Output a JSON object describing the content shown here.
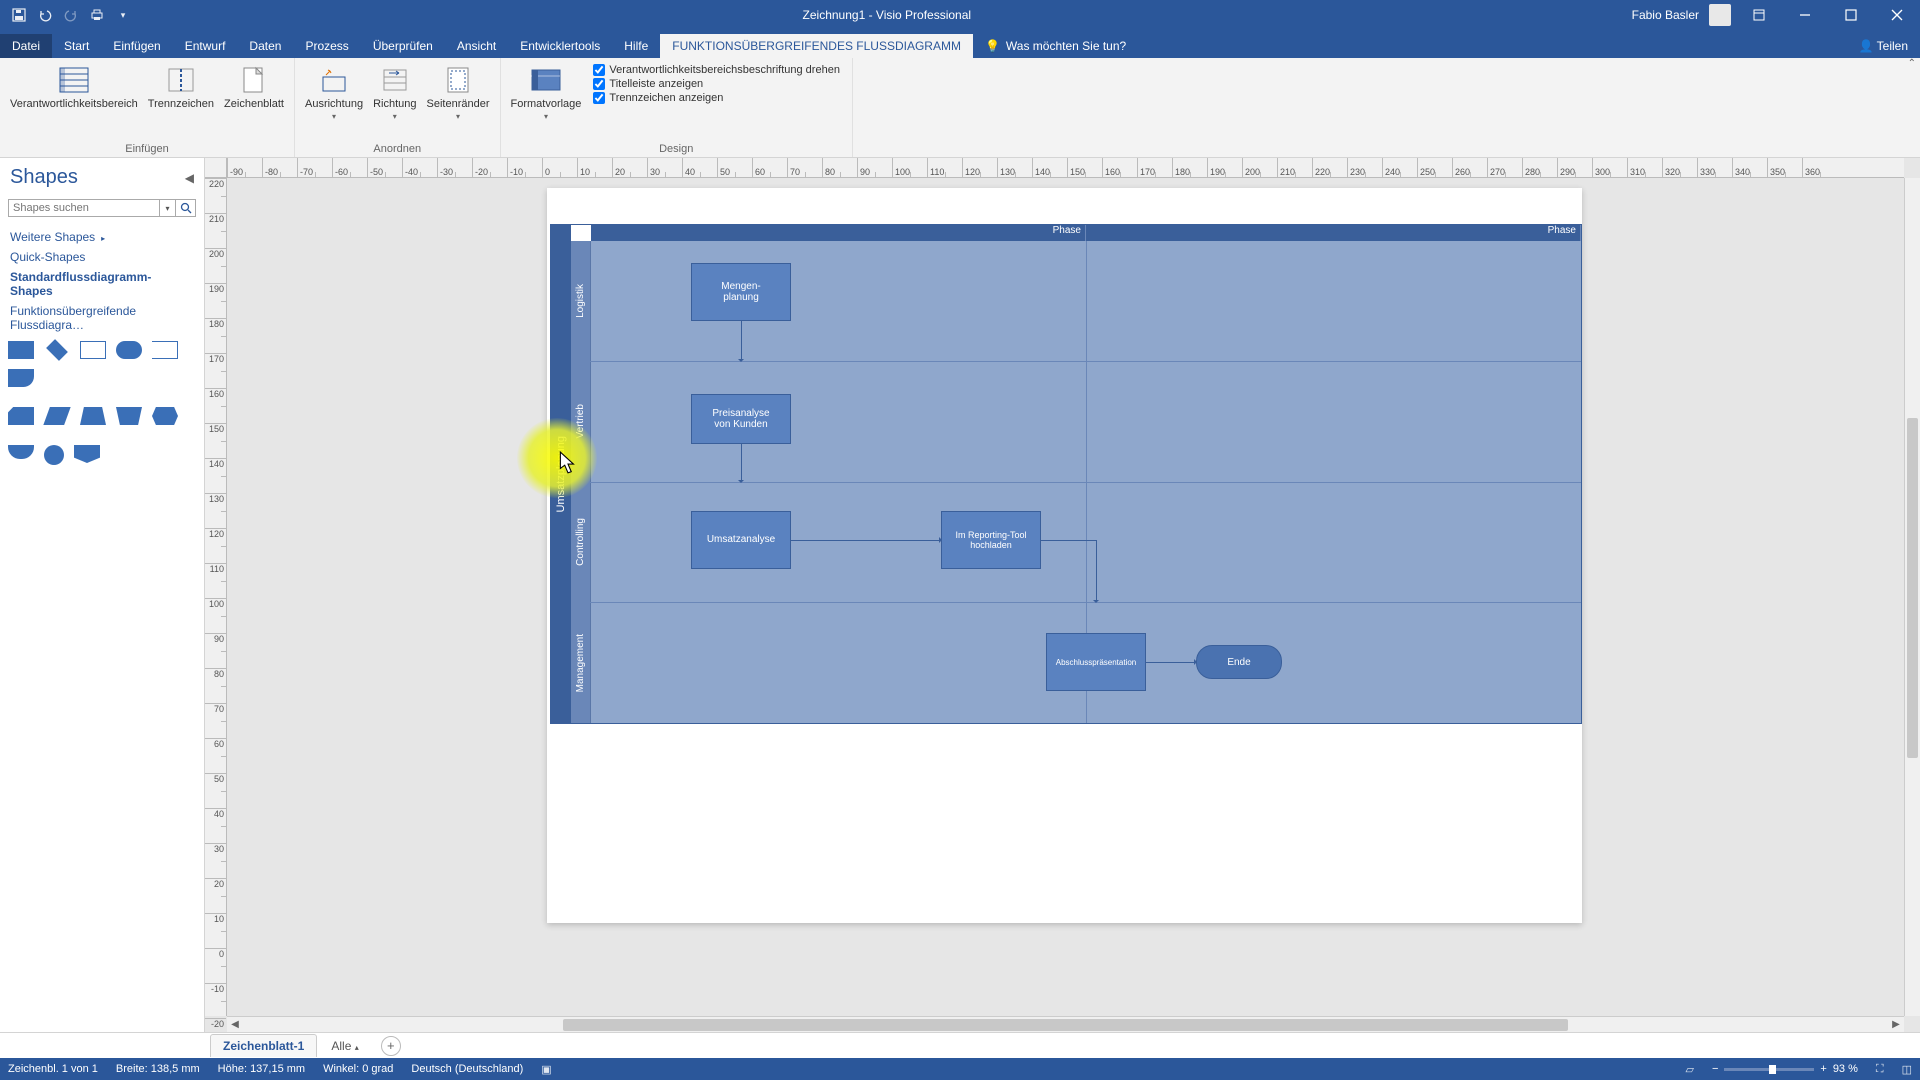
{
  "app": {
    "title": "Zeichnung1  -  Visio Professional",
    "user": "Fabio Basler"
  },
  "tabs": {
    "file": "Datei",
    "items": [
      "Start",
      "Einfügen",
      "Entwurf",
      "Daten",
      "Prozess",
      "Überprüfen",
      "Ansicht",
      "Entwicklertools",
      "Hilfe",
      "FUNKTIONSÜBERGREIFENDES FLUSSDIAGRAMM"
    ],
    "tell_placeholder": "Was möchten Sie tun?",
    "share": "Teilen"
  },
  "ribbon": {
    "insert": {
      "label": "Einfügen",
      "swimlane": "Verantwortlichkeitsbereich",
      "separator": "Trennzeichen",
      "page": "Zeichenblatt"
    },
    "arrange": {
      "label": "Anordnen",
      "orientation": "Ausrichtung",
      "direction": "Richtung",
      "margins": "Seitenränder"
    },
    "design": {
      "label": "Design",
      "style": "Formatvorlage",
      "rotate": "Verantwortlichkeitsbereichsbeschriftung drehen",
      "titlebar": "Titelleiste anzeigen",
      "separators": "Trennzeichen anzeigen"
    }
  },
  "shapes": {
    "title": "Shapes",
    "search_placeholder": "Shapes suchen",
    "more": "Weitere Shapes",
    "quick": "Quick-Shapes",
    "std": "Standardflussdiagramm-Shapes",
    "cross": "Funktionsübergreifende Flussdiagra…"
  },
  "diagram": {
    "main_title": "Umsatzplanung",
    "phase": "Phase",
    "lanes": [
      "Logistik",
      "Vertrieb",
      "Controlling",
      "Management"
    ],
    "nodes": {
      "n1": "Mengen-\nplanung",
      "n2": "Preisanalyse\nvon Kunden",
      "n3": "Umsatzanalyse",
      "n4": "Im Reporting-Tool\nhochladen",
      "n5": "Abschlusspräsentation",
      "n6": "Ende"
    }
  },
  "pagetabs": {
    "page1": "Zeichenblatt-1",
    "all": "Alle"
  },
  "status": {
    "page": "Zeichenbl. 1 von 1",
    "width": "Breite: 138,5 mm",
    "height": "Höhe: 137,15 mm",
    "angle": "Winkel: 0 grad",
    "lang": "Deutsch (Deutschland)",
    "zoom": "93 %"
  },
  "ruler_h": [
    "-90",
    "-80",
    "-70",
    "-60",
    "-50",
    "-40",
    "-30",
    "-20",
    "-10",
    "0",
    "10",
    "20",
    "30",
    "40",
    "50",
    "60",
    "70",
    "80",
    "90",
    "100",
    "110",
    "120",
    "130",
    "140",
    "150",
    "160",
    "170",
    "180",
    "190",
    "200",
    "210",
    "220",
    "230",
    "240",
    "250",
    "260",
    "270",
    "280",
    "290",
    "300",
    "310",
    "320",
    "330",
    "340",
    "350",
    "360"
  ],
  "ruler_v": [
    "220",
    "210",
    "200",
    "190",
    "180",
    "170",
    "160",
    "150",
    "140",
    "130",
    "120",
    "110",
    "100",
    "90",
    "80",
    "70",
    "60",
    "50",
    "40",
    "30",
    "20",
    "10",
    "0",
    "-10",
    "-20"
  ]
}
